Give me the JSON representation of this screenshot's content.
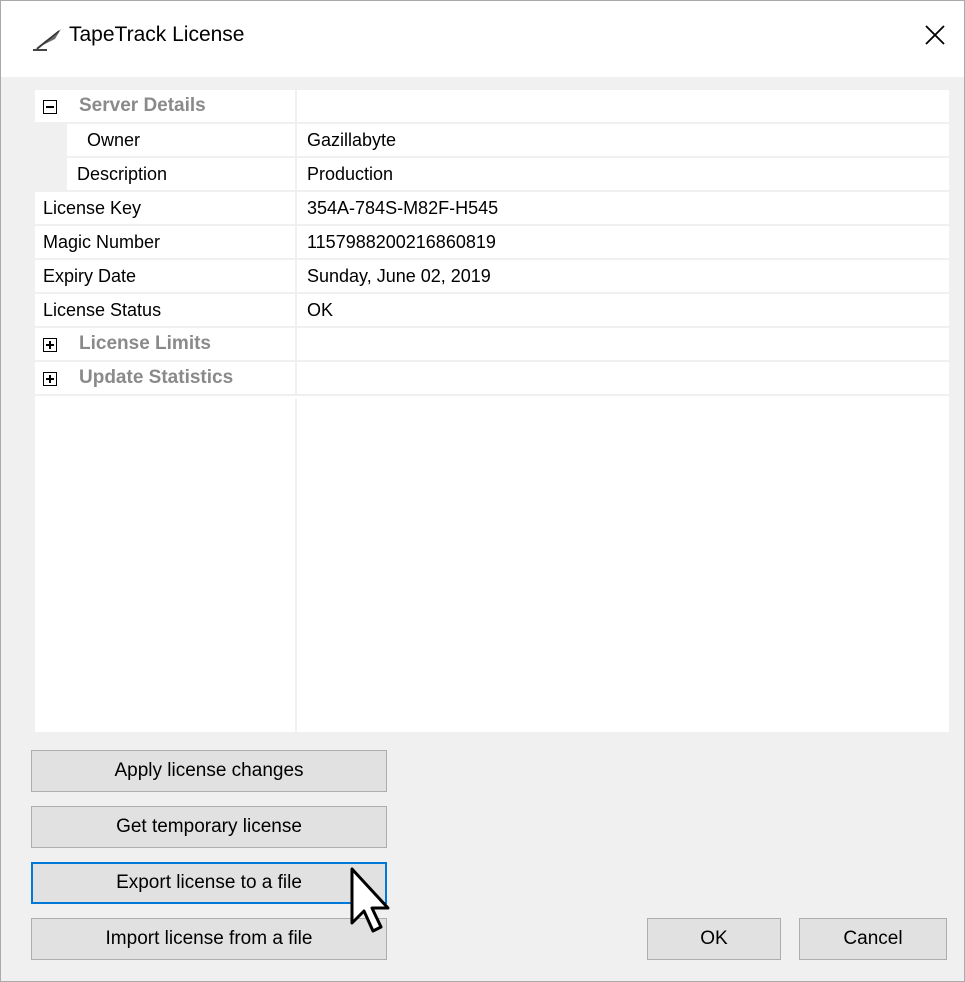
{
  "window": {
    "title": "TapeTrack License",
    "icons": {
      "app": "tapetrack-feather-icon",
      "close": "close-icon"
    }
  },
  "grid": {
    "server_details": {
      "label": "Server Details",
      "expanded": true,
      "rows": [
        {
          "name": "Owner",
          "value": "Gazillabyte"
        },
        {
          "name": "Description",
          "value": "Production"
        }
      ]
    },
    "rows": [
      {
        "name": "License Key",
        "value": "354A-784S-M82F-H545"
      },
      {
        "name": "Magic Number",
        "value": "1157988200216860819"
      },
      {
        "name": "Expiry Date",
        "value": "Sunday, June 02, 2019"
      },
      {
        "name": "License Status",
        "value": "OK"
      }
    ],
    "license_limits": {
      "label": "License Limits",
      "expanded": false
    },
    "update_statistics": {
      "label": "Update Statistics",
      "expanded": false
    }
  },
  "buttons": {
    "apply": "Apply license changes",
    "temporary": "Get temporary license",
    "export": "Export license to a file",
    "import": "Import license from a file",
    "ok": "OK",
    "cancel": "Cancel"
  }
}
